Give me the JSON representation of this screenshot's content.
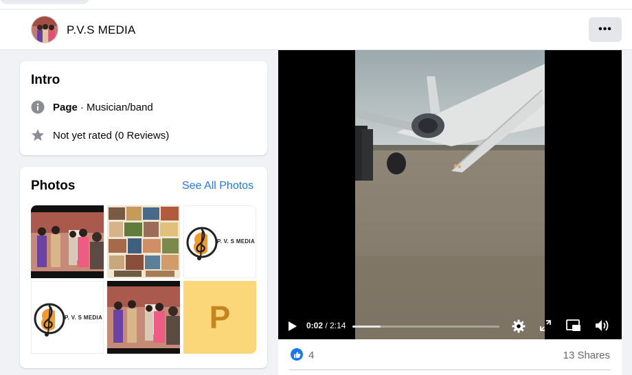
{
  "page": {
    "name": "P.V.S MEDIA",
    "more_label": "•••"
  },
  "intro": {
    "title": "Intro",
    "category_bold": "Page",
    "category_rest": "· Musician/band",
    "rating": "Not yet rated (0 Reviews)"
  },
  "photos": {
    "title": "Photos",
    "see_all": "See All Photos",
    "logo_text": "P. V. S MEDIA",
    "placeholder_letter": "P"
  },
  "video": {
    "current_time": "0:02",
    "separator": " / ",
    "duration": "2:14",
    "progress": 0.19
  },
  "engagement": {
    "likes": "4",
    "shares": "13 Shares"
  },
  "colors": {
    "accent": "#1877f2",
    "placeholder_bg": "#fcd77a",
    "placeholder_fg": "#c7851f"
  },
  "icons": [
    "info-icon",
    "star-icon",
    "play-icon",
    "settings-icon",
    "fullscreen-icon",
    "picture-in-picture-icon",
    "volume-icon",
    "like-icon",
    "more-icon"
  ]
}
